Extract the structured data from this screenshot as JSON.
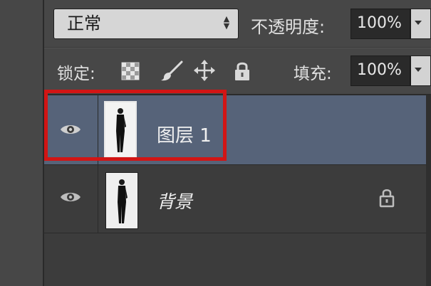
{
  "options": {
    "blend_mode": "正常",
    "opacity_label": "不透明度:",
    "opacity_value": "100%",
    "lock_label": "锁定:",
    "fill_label": "填充:",
    "fill_value": "100%"
  },
  "icons": {
    "lock_transparent": "checkerboard-icon",
    "lock_pixels": "brush-icon",
    "lock_position": "move-icon",
    "lock_all": "lock-icon",
    "visibility": "eye-icon",
    "background_lock": "lock-icon"
  },
  "layers": [
    {
      "name": "图层 1",
      "selected": true,
      "visible": true
    },
    {
      "name": "背景",
      "selected": false,
      "visible": true,
      "locked": true
    }
  ],
  "colors": {
    "selection": "#566379",
    "highlight_box": "#d21515",
    "panel": "#474747"
  }
}
